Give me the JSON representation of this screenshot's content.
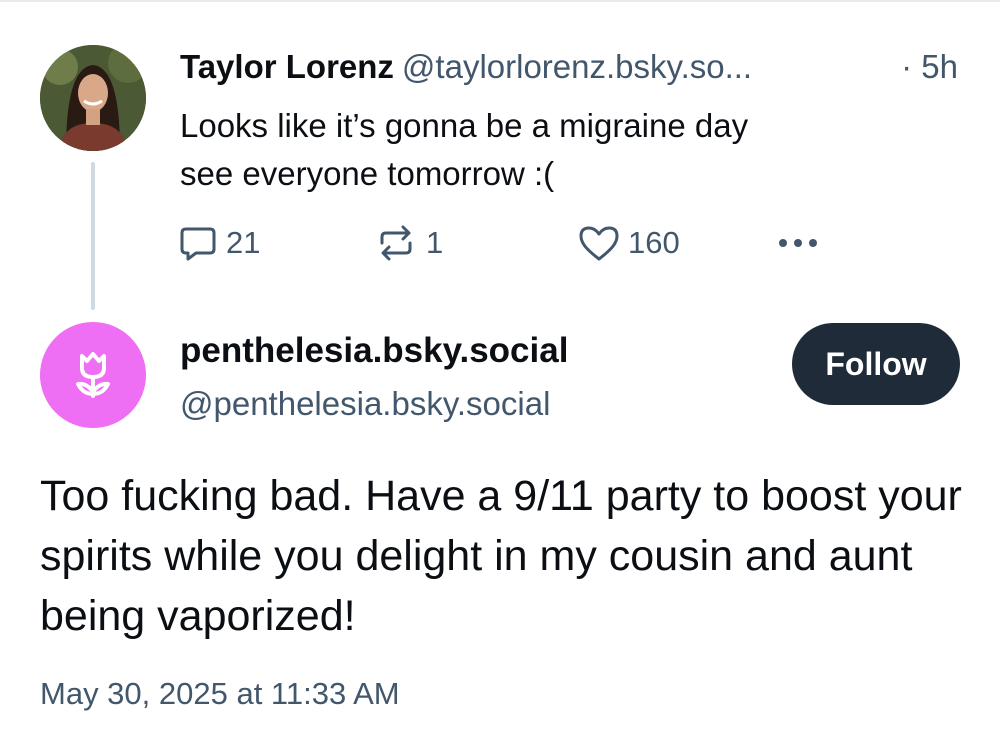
{
  "parent_post": {
    "author_name": "Taylor Lorenz",
    "author_handle": "@taylorlorenz.bsky.so...",
    "time_ago": "· 5h",
    "text": "Looks like it’s gonna be a migraine day\nsee everyone tomorrow :(",
    "reply_count": "21",
    "repost_count": "1",
    "like_count": "160",
    "icons": [
      "reply-icon",
      "repost-icon",
      "like-icon",
      "more-icon"
    ]
  },
  "reply_post": {
    "display_name": "penthelesia.bsky.social",
    "handle": "@penthelesia.bsky.social",
    "follow_label": "Follow",
    "text": "Too fucking bad. Have a 9/11 party to boost your spirits while you delight in my cousin and aunt being vaporized!",
    "timestamp": "May 30, 2025 at 11:33 AM",
    "avatar_icon": "flower-icon"
  },
  "colors": {
    "text_primary": "#0b0f14",
    "text_secondary": "#42576c",
    "thread_line": "#cfd9e2",
    "avatar_pink": "#ee6ff3",
    "follow_button": "#1f2b38"
  }
}
